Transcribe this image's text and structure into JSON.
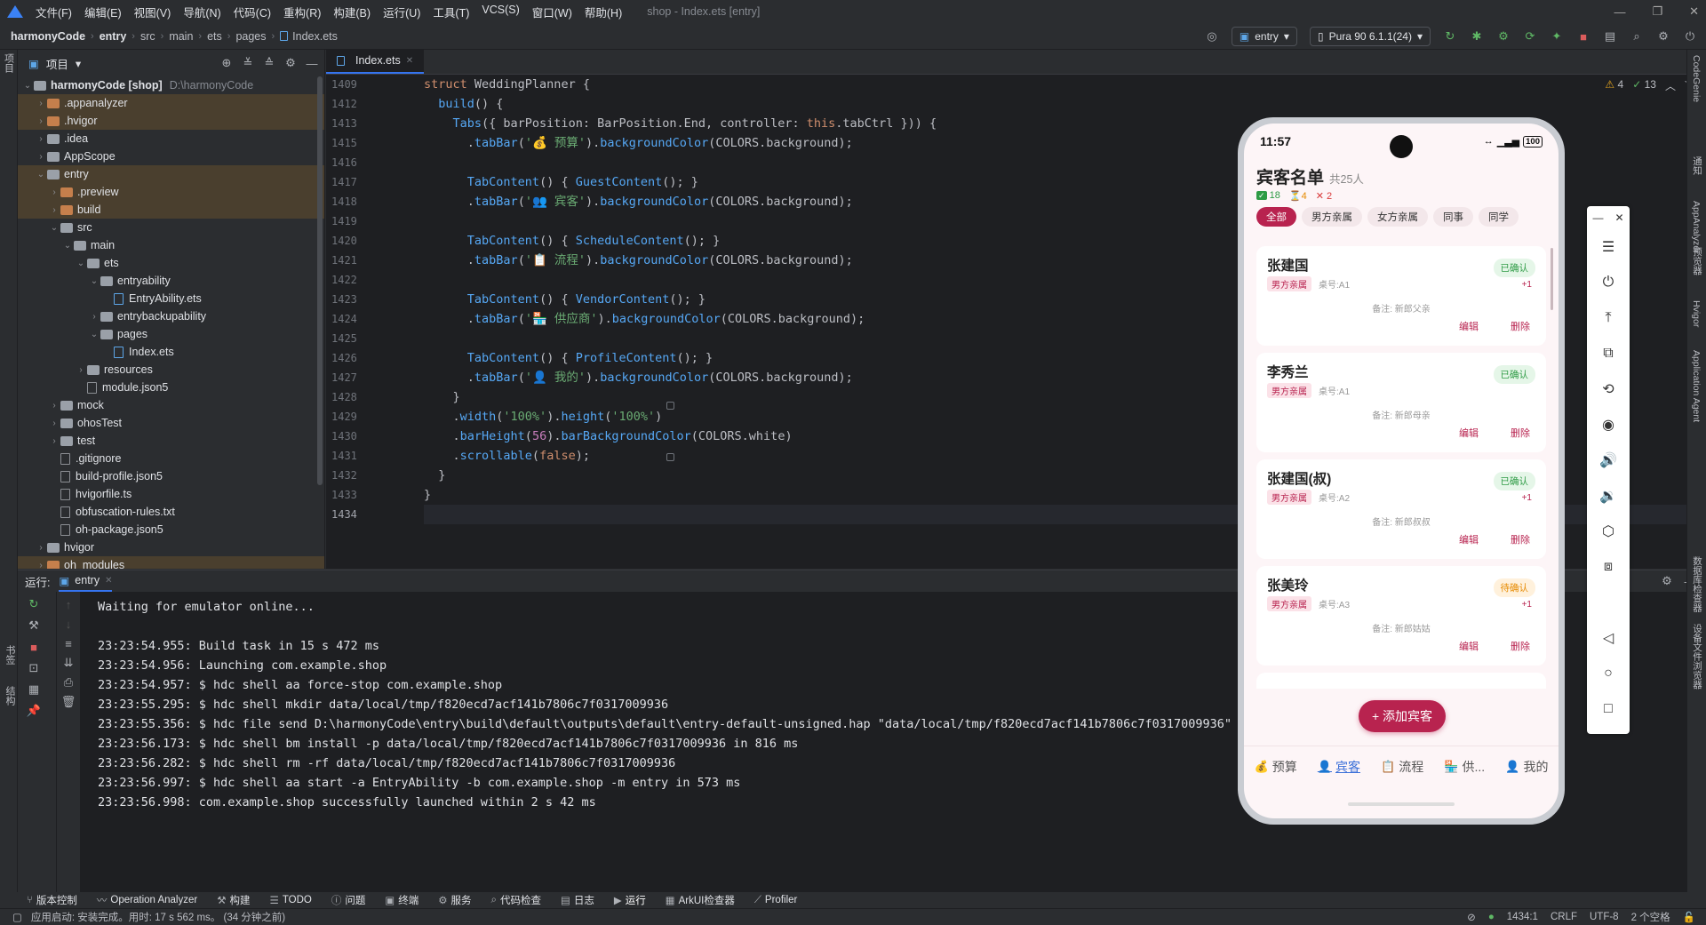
{
  "menu": {
    "items": [
      "文件(F)",
      "编辑(E)",
      "视图(V)",
      "导航(N)",
      "代码(C)",
      "重构(R)",
      "构建(B)",
      "运行(U)",
      "工具(T)",
      "VCS(S)",
      "窗口(W)",
      "帮助(H)"
    ],
    "window_title": "shop - Index.ets [entry]"
  },
  "breadcrumb": [
    "harmonyCode",
    "entry",
    "src",
    "main",
    "ets",
    "pages",
    "Index.ets"
  ],
  "toolbar": {
    "module": "entry",
    "device": "Pura 90 6.1.1(24)"
  },
  "project": {
    "title": "项目",
    "root": "harmonyCode [shop]",
    "root_path": "D:\\harmonyCode",
    "tree": [
      {
        "label": ".appanalyzer",
        "depth": 1,
        "type": "folder-o",
        "arrow": "›"
      },
      {
        "label": ".hvigor",
        "depth": 1,
        "type": "folder-o",
        "arrow": "›"
      },
      {
        "label": ".idea",
        "depth": 1,
        "type": "folder",
        "arrow": "›"
      },
      {
        "label": "AppScope",
        "depth": 1,
        "type": "folder",
        "arrow": "›"
      },
      {
        "label": "entry",
        "depth": 1,
        "type": "folder",
        "arrow": "⌄"
      },
      {
        "label": ".preview",
        "depth": 2,
        "type": "folder-o",
        "arrow": "›"
      },
      {
        "label": "build",
        "depth": 2,
        "type": "folder-o",
        "arrow": "›"
      },
      {
        "label": "src",
        "depth": 2,
        "type": "folder",
        "arrow": "⌄"
      },
      {
        "label": "main",
        "depth": 3,
        "type": "folder",
        "arrow": "⌄"
      },
      {
        "label": "ets",
        "depth": 4,
        "type": "folder",
        "arrow": "⌄"
      },
      {
        "label": "entryability",
        "depth": 5,
        "type": "folder",
        "arrow": "⌄"
      },
      {
        "label": "EntryAbility.ets",
        "depth": 6,
        "type": "file-ets",
        "arrow": ""
      },
      {
        "label": "entrybackupability",
        "depth": 5,
        "type": "folder",
        "arrow": "›"
      },
      {
        "label": "pages",
        "depth": 5,
        "type": "folder",
        "arrow": "⌄"
      },
      {
        "label": "Index.ets",
        "depth": 6,
        "type": "file-ets",
        "arrow": ""
      },
      {
        "label": "resources",
        "depth": 4,
        "type": "folder",
        "arrow": "›"
      },
      {
        "label": "module.json5",
        "depth": 4,
        "type": "file",
        "arrow": ""
      },
      {
        "label": "mock",
        "depth": 2,
        "type": "folder",
        "arrow": "›"
      },
      {
        "label": "ohosTest",
        "depth": 2,
        "type": "folder",
        "arrow": "›"
      },
      {
        "label": "test",
        "depth": 2,
        "type": "folder",
        "arrow": "›"
      },
      {
        "label": ".gitignore",
        "depth": 2,
        "type": "file",
        "arrow": ""
      },
      {
        "label": "build-profile.json5",
        "depth": 2,
        "type": "file",
        "arrow": ""
      },
      {
        "label": "hvigorfile.ts",
        "depth": 2,
        "type": "file",
        "arrow": ""
      },
      {
        "label": "obfuscation-rules.txt",
        "depth": 2,
        "type": "file",
        "arrow": ""
      },
      {
        "label": "oh-package.json5",
        "depth": 2,
        "type": "file",
        "arrow": ""
      },
      {
        "label": "hvigor",
        "depth": 1,
        "type": "folder",
        "arrow": "›"
      },
      {
        "label": "oh_modules",
        "depth": 1,
        "type": "folder-o",
        "arrow": "›"
      }
    ]
  },
  "editor": {
    "tab": "Index.ets",
    "warnings": "4",
    "checks": "13",
    "line_numbers": [
      "1409",
      "1412",
      "1413",
      "1415",
      "1416",
      "1417",
      "1418",
      "1419",
      "1420",
      "1421",
      "1422",
      "1423",
      "1424",
      "1425",
      "1426",
      "1427",
      "1428",
      "1429",
      "1430",
      "1431",
      "1432",
      "1433",
      "1434"
    ],
    "code": [
      [
        [
          "kw",
          "struct "
        ],
        [
          "ty",
          "WeddingPlanner {"
        ]
      ],
      [
        [
          "ty",
          "  "
        ],
        [
          "fn",
          "build"
        ],
        [
          "ty",
          "() {"
        ]
      ],
      [
        [
          "ty",
          "    "
        ],
        [
          "fn",
          "Tabs"
        ],
        [
          "ty",
          "({ barPosition: BarPosition.End, controller: "
        ],
        [
          "kw",
          "this"
        ],
        [
          "ty",
          ".tabCtrl })) {"
        ]
      ],
      [
        [
          "ty",
          "      ."
        ],
        [
          "fn",
          "tabBar"
        ],
        [
          "ty",
          "("
        ],
        [
          "st",
          "'💰 预算'"
        ],
        [
          "ty",
          ")."
        ],
        [
          "fn",
          "backgroundColor"
        ],
        [
          "ty",
          "(COLORS.background);"
        ]
      ],
      [
        [
          "ty",
          ""
        ]
      ],
      [
        [
          "ty",
          "      "
        ],
        [
          "fn",
          "TabContent"
        ],
        [
          "ty",
          "() { "
        ],
        [
          "fn",
          "GuestContent"
        ],
        [
          "ty",
          "(); }"
        ]
      ],
      [
        [
          "ty",
          "      ."
        ],
        [
          "fn",
          "tabBar"
        ],
        [
          "ty",
          "("
        ],
        [
          "st",
          "'👥 宾客'"
        ],
        [
          "ty",
          ")."
        ],
        [
          "fn",
          "backgroundColor"
        ],
        [
          "ty",
          "(COLORS.background);"
        ]
      ],
      [
        [
          "ty",
          ""
        ]
      ],
      [
        [
          "ty",
          "      "
        ],
        [
          "fn",
          "TabContent"
        ],
        [
          "ty",
          "() { "
        ],
        [
          "fn",
          "ScheduleContent"
        ],
        [
          "ty",
          "(); }"
        ]
      ],
      [
        [
          "ty",
          "      ."
        ],
        [
          "fn",
          "tabBar"
        ],
        [
          "ty",
          "("
        ],
        [
          "st",
          "'📋 流程'"
        ],
        [
          "ty",
          ")."
        ],
        [
          "fn",
          "backgroundColor"
        ],
        [
          "ty",
          "(COLORS.background);"
        ]
      ],
      [
        [
          "ty",
          ""
        ]
      ],
      [
        [
          "ty",
          "      "
        ],
        [
          "fn",
          "TabContent"
        ],
        [
          "ty",
          "() { "
        ],
        [
          "fn",
          "VendorContent"
        ],
        [
          "ty",
          "(); }"
        ]
      ],
      [
        [
          "ty",
          "      ."
        ],
        [
          "fn",
          "tabBar"
        ],
        [
          "ty",
          "("
        ],
        [
          "st",
          "'🏪 供应商'"
        ],
        [
          "ty",
          ")."
        ],
        [
          "fn",
          "backgroundColor"
        ],
        [
          "ty",
          "(COLORS.background);"
        ]
      ],
      [
        [
          "ty",
          ""
        ]
      ],
      [
        [
          "ty",
          "      "
        ],
        [
          "fn",
          "TabContent"
        ],
        [
          "ty",
          "() { "
        ],
        [
          "fn",
          "ProfileContent"
        ],
        [
          "ty",
          "(); }"
        ]
      ],
      [
        [
          "ty",
          "      ."
        ],
        [
          "fn",
          "tabBar"
        ],
        [
          "ty",
          "("
        ],
        [
          "st",
          "'👤 我的'"
        ],
        [
          "ty",
          ")."
        ],
        [
          "fn",
          "backgroundColor"
        ],
        [
          "ty",
          "(COLORS.background);"
        ]
      ],
      [
        [
          "ty",
          "    }"
        ]
      ],
      [
        [
          "ty",
          "    ."
        ],
        [
          "fn",
          "width"
        ],
        [
          "ty",
          "("
        ],
        [
          "st",
          "'100%'"
        ],
        [
          "ty",
          ")."
        ],
        [
          "fn",
          "height"
        ],
        [
          "ty",
          "("
        ],
        [
          "st",
          "'100%'"
        ],
        [
          "ty",
          ")"
        ]
      ],
      [
        [
          "ty",
          "    ."
        ],
        [
          "fn",
          "barHeight"
        ],
        [
          "ty",
          "("
        ],
        [
          "cn",
          "56"
        ],
        [
          "ty",
          ")."
        ],
        [
          "fn",
          "barBackgroundColor"
        ],
        [
          "ty",
          "(COLORS.white)"
        ]
      ],
      [
        [
          "ty",
          "    ."
        ],
        [
          "fn",
          "scrollable"
        ],
        [
          "ty",
          "("
        ],
        [
          "kw",
          "false"
        ],
        [
          "ty",
          ");"
        ]
      ],
      [
        [
          "ty",
          "  }"
        ]
      ],
      [
        [
          "ty",
          "}"
        ]
      ],
      [
        [
          "ty",
          ""
        ]
      ]
    ]
  },
  "run": {
    "label": "运行:",
    "config": "entry",
    "lines": [
      "Waiting for emulator online...",
      "",
      "23:23:54.955: Build task in 15 s 472 ms",
      "23:23:54.956: Launching com.example.shop",
      "23:23:54.957: $ hdc shell aa force-stop com.example.shop",
      "23:23:55.295: $ hdc shell mkdir data/local/tmp/f820ecd7acf141b7806c7f0317009936",
      "23:23:55.356: $ hdc file send D:\\harmonyCode\\entry\\build\\default\\outputs\\default\\entry-default-unsigned.hap \"data/local/tmp/f820ecd7acf141b7806c7f0317009936\" in 61",
      "23:23:56.173: $ hdc shell bm install -p data/local/tmp/f820ecd7acf141b7806c7f0317009936 in 816 ms",
      "23:23:56.282: $ hdc shell rm -rf data/local/tmp/f820ecd7acf141b7806c7f0317009936",
      "23:23:56.997: $ hdc shell aa start -a EntryAbility -b com.example.shop -m entry in 573 ms",
      "23:23:56.998: com.example.shop successfully launched within 2 s 42 ms"
    ]
  },
  "bottom_tabs": [
    "版本控制",
    "Operation Analyzer",
    "构建",
    "TODO",
    "问题",
    "终端",
    "服务",
    "代码检查",
    "日志",
    "运行",
    "ArkUI检查器",
    "Profiler"
  ],
  "status": {
    "message": "应用启动: 安装完成。用时: 17 s 562 ms。 (34 分钟之前)",
    "position": "1434:1",
    "line_sep": "CRLF",
    "encoding": "UTF-8",
    "indent": "2 个空格"
  },
  "right_strip": [
    "CodeGenie",
    "通知",
    "AppAnalyzer",
    "预览器",
    "Hvigor",
    "Application Agent",
    "数据库检查器",
    "设备文件浏览器"
  ],
  "left_strip": [
    "项目",
    "书签",
    "结构"
  ],
  "phone": {
    "time": "11:57",
    "battery": "100",
    "title": "宾客名单",
    "total": "共25人",
    "confirmed": "18",
    "pending": "4",
    "declined": "2",
    "filters": [
      "全部",
      "男方亲属",
      "女方亲属",
      "同事",
      "同学"
    ],
    "guests": [
      {
        "name": "张建国",
        "tag": "男方亲属",
        "table": "桌号:A1",
        "note": "备注: 新郎父亲",
        "status": "已确认",
        "plus": "+1",
        "edit": "编辑",
        "delete": "删除"
      },
      {
        "name": "李秀兰",
        "tag": "男方亲属",
        "table": "桌号:A1",
        "note": "备注: 新郎母亲",
        "status": "已确认",
        "plus": "",
        "edit": "编辑",
        "delete": "删除"
      },
      {
        "name": "张建国(叔)",
        "tag": "男方亲属",
        "table": "桌号:A2",
        "note": "备注: 新郎叔叔",
        "status": "已确认",
        "plus": "+1",
        "edit": "编辑",
        "delete": "删除"
      },
      {
        "name": "张美玲",
        "tag": "男方亲属",
        "table": "桌号:A3",
        "note": "备注: 新郎姑姑",
        "status": "待确认",
        "plus": "+1",
        "edit": "编辑",
        "delete": "删除"
      }
    ],
    "add_button": "+ 添加宾客",
    "tabs": [
      {
        "icon": "💰",
        "label": "预算"
      },
      {
        "icon": "👤",
        "label": "宾客"
      },
      {
        "icon": "📋",
        "label": "流程"
      },
      {
        "icon": "🏪",
        "label": "供..."
      },
      {
        "icon": "👤",
        "label": "我的"
      }
    ]
  },
  "colors": {
    "accent": "#b8234f",
    "confirmed": "#2e9b45",
    "pending": "#e68a00",
    "declined": "#d93a3a",
    "tab_active": "#3a6fd8"
  }
}
